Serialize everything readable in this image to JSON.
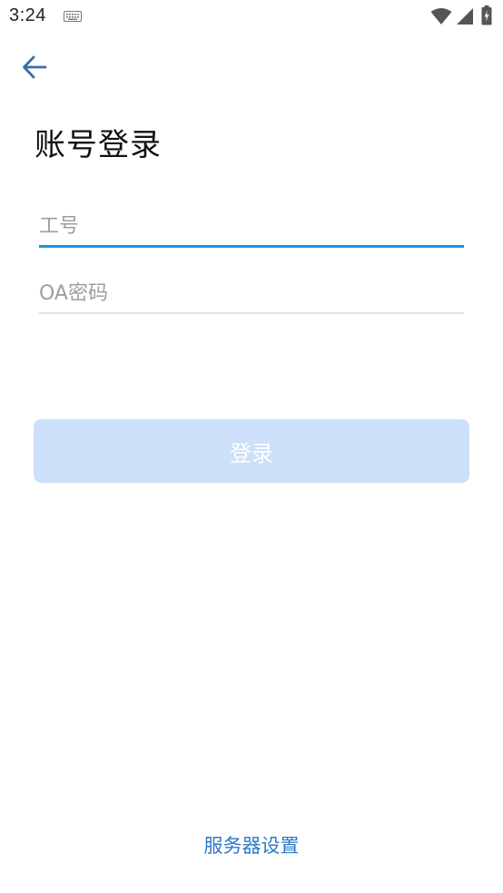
{
  "status_bar": {
    "time": "3:24",
    "icons": [
      "keyboard-icon",
      "wifi-icon",
      "signal-icon",
      "battery-charging-icon"
    ]
  },
  "navigation": {
    "back_icon": "arrow-left-icon"
  },
  "login": {
    "title": "账号登录",
    "employee_id_placeholder": "工号",
    "password_placeholder": "OA密码",
    "login_button_label": "登录",
    "server_settings_label": "服务器设置"
  },
  "colors": {
    "accent_blue": "#1e96e6",
    "button_disabled": "#cce0f9",
    "link_blue": "#2f78c4",
    "back_arrow": "#3a6ea5"
  }
}
